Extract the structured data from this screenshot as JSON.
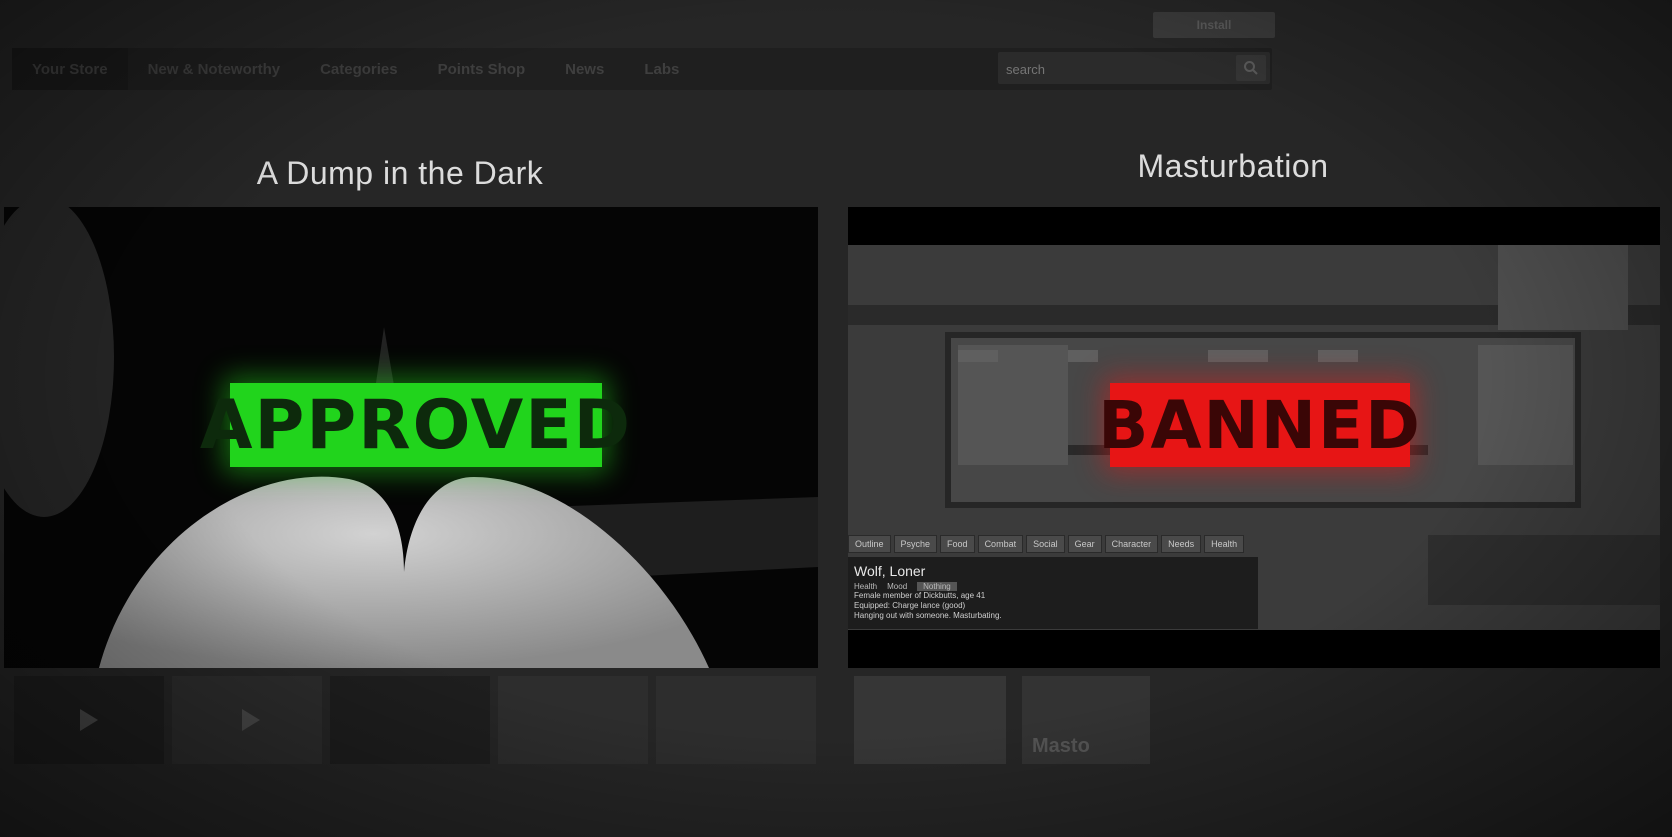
{
  "topbar": {
    "install_label": "Install"
  },
  "nav": {
    "items": [
      {
        "label": "Your Store"
      },
      {
        "label": "New & Noteworthy"
      },
      {
        "label": "Categories"
      },
      {
        "label": "Points Shop"
      },
      {
        "label": "News"
      },
      {
        "label": "Labs"
      }
    ],
    "search_placeholder": "search",
    "search_icon": "search-icon"
  },
  "left": {
    "title": "A Dump in the Dark",
    "stamp": "APPROVED",
    "stamp_color": "#21d41c",
    "thumb_icons": [
      "play-icon",
      "play-icon"
    ]
  },
  "right": {
    "title": "Masturbation",
    "stamp": "BANNED",
    "stamp_color": "#e71515",
    "game_ui": {
      "tabs": [
        "Outline",
        "Psyche",
        "Food",
        "Combat",
        "Social",
        "Gear",
        "Character",
        "Needs",
        "Health"
      ],
      "char_name": "Wolf, Loner",
      "stat_health": "Health",
      "stat_mood": "Mood",
      "stat_status": "Nothing",
      "lines": [
        "Female member of Dickbutts, age 41",
        "Equipped: Charge lance (good)",
        "Hanging out with someone. Masturbating."
      ]
    },
    "thumb_text": "Masto"
  }
}
